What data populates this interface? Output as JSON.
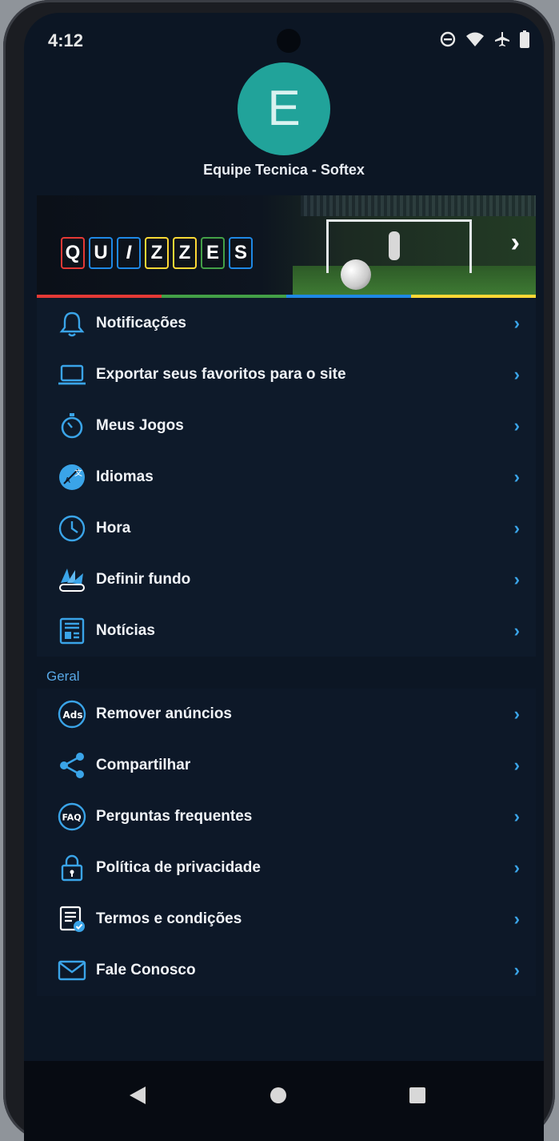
{
  "status": {
    "time": "4:12"
  },
  "profile": {
    "initial": "E",
    "name": "Equipe Tecnica - Softex"
  },
  "banner": {
    "letters": [
      "Q",
      "U",
      "I",
      "Z",
      "Z",
      "E",
      "S"
    ],
    "letter_colors": [
      "#e53935",
      "#1e88e5",
      "#1e88e5",
      "#fdd835",
      "#fdd835",
      "#43a047",
      "#1e88e5"
    ],
    "strip_colors": [
      "#e53935",
      "#43a047",
      "#1e88e5",
      "#fdd835"
    ],
    "chevron": "›"
  },
  "menu": {
    "items": [
      {
        "label": "Notificações",
        "icon": "bell-icon"
      },
      {
        "label": "Exportar seus favoritos para o site",
        "icon": "laptop-icon"
      },
      {
        "label": "Meus Jogos",
        "icon": "stopwatch-icon"
      },
      {
        "label": "Idiomas",
        "icon": "language-icon"
      },
      {
        "label": "Hora",
        "icon": "clock-icon"
      },
      {
        "label": "Definir fundo",
        "icon": "palette-icon"
      },
      {
        "label": "Notícias",
        "icon": "newspaper-icon"
      }
    ],
    "general_title": "Geral",
    "general": [
      {
        "label": "Remover anúncios",
        "icon": "ads-icon"
      },
      {
        "label": "Compartilhar",
        "icon": "share-icon"
      },
      {
        "label": "Perguntas frequentes",
        "icon": "faq-icon"
      },
      {
        "label": "Política de privacidade",
        "icon": "lock-icon"
      },
      {
        "label": "Termos e condições",
        "icon": "document-check-icon"
      },
      {
        "label": "Fale Conosco",
        "icon": "mail-icon"
      }
    ],
    "chevron": "›"
  },
  "nav": {
    "back": "back-icon",
    "home": "home-icon",
    "recents": "recents-icon"
  },
  "colors": {
    "accent": "#3aa4e8",
    "avatar": "#21a39a",
    "background": "#0c1624"
  }
}
